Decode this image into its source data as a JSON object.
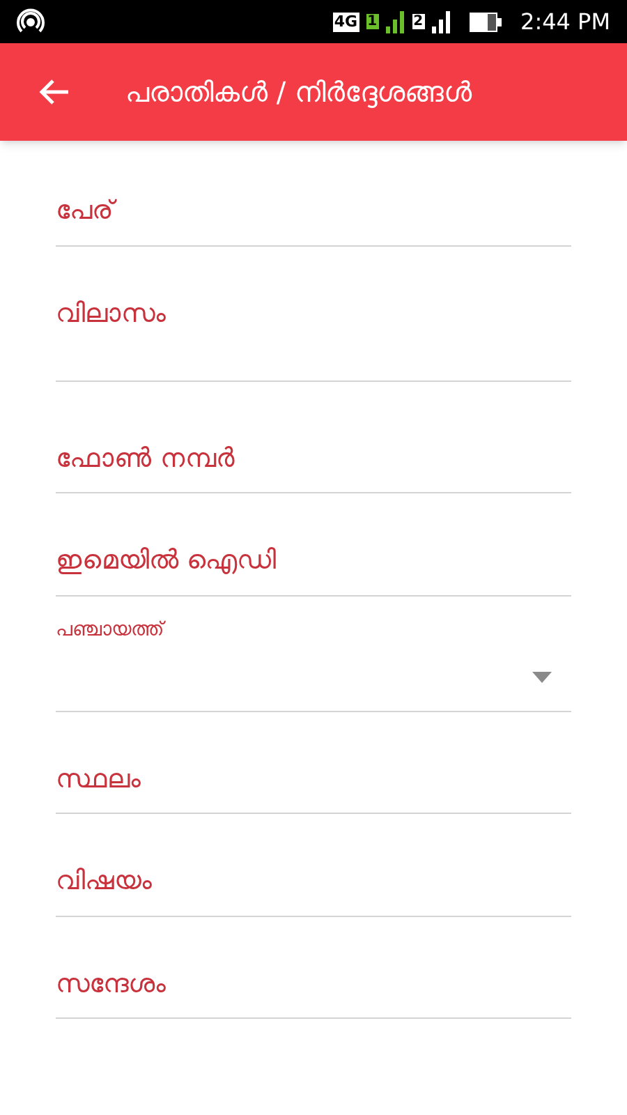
{
  "status_bar": {
    "network": "4G",
    "sim_1": "1",
    "sim_2": "2",
    "time": "2:44 PM"
  },
  "app_bar": {
    "title": "പരാതികൾ / നിർദ്ദേശങ്ങൾ"
  },
  "fields": [
    {
      "kind": "text",
      "placeholder": "പേര്"
    },
    {
      "kind": "text",
      "placeholder": "വിലാസം",
      "multiline": true
    },
    {
      "kind": "text",
      "placeholder": "ഫോൺ നമ്പർ"
    },
    {
      "kind": "text",
      "placeholder": "ഇമെയിൽ ഐഡി"
    },
    {
      "kind": "dropdown",
      "label": "പഞ്ചായത്ത്"
    },
    {
      "kind": "text",
      "placeholder": "സ്ഥലം"
    },
    {
      "kind": "text",
      "placeholder": "വിഷയം"
    },
    {
      "kind": "text",
      "placeholder": "സന്ദേശം"
    }
  ]
}
